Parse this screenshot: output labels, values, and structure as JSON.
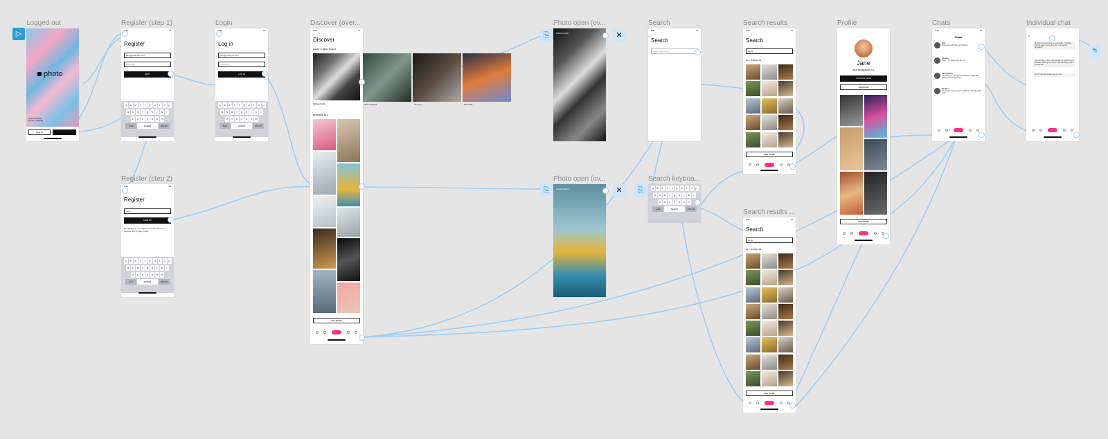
{
  "frames": {
    "logged_out": {
      "label": "Logged out",
      "brand": "photo",
      "login_btn": "LOG IN",
      "footer_name": "Pawel Czerwinski",
      "footer_sub": "@pawel_czerwinski"
    },
    "register1": {
      "label": "Register (step 1)",
      "title": "Register",
      "email_value": "jane@example.com",
      "password_placeholder": "Password",
      "button": "NEXT"
    },
    "login": {
      "label": "Login",
      "title": "Log in",
      "email_value": "jane@example.com",
      "password_placeholder": "Password",
      "button": "LOG IN"
    },
    "register2": {
      "label": "Register (step 2)",
      "title": "Register",
      "name_value": "Jane",
      "button": "SIGN UP",
      "terms": "By signing up, you agree to Photo's Terms of Service and Privacy Policy."
    },
    "discover": {
      "label": "Discover (over...",
      "title": "Discover",
      "section1": "WHAT'S NEW TODAY",
      "section2": "BROWSE ALL",
      "see_more": "SEE MORE",
      "featured": [
        {
          "name": "Ridhwan Nordin",
          "handle": "@ridzjcb"
        },
        {
          "name": "Clem Onojeghuo",
          "handle": "@clemono2"
        },
        {
          "name": "Jon Tyson",
          "handle": "@jontyson"
        },
        {
          "name": "Chema Ma",
          "handle": "@chemama"
        }
      ]
    },
    "photo_open1": {
      "label": "Photo open (ov...",
      "user": "Ridhwan Nordin",
      "handle": "@ridzjcb"
    },
    "photo_open2": {
      "label": "Photo open (ov...",
      "user": "Angelo Pantazis",
      "handle": "@angelopantazis"
    },
    "search": {
      "label": "Search",
      "title": "Search",
      "placeholder": "Search all photos"
    },
    "search_keyboard": {
      "label": "Search keyboa..."
    },
    "search_results1": {
      "label": "Search results",
      "title": "Search",
      "query": "Dogs",
      "section": "ALL RESULTS",
      "see_more": "SEE MORE"
    },
    "search_results2": {
      "label": "Search results ...",
      "title": "Search",
      "query": "Dogs",
      "section": "ALL RESULTS",
      "see_more": "SEE MORE"
    },
    "profile": {
      "label": "Profile",
      "name": "Jane",
      "location": "SAN FRANCISCO, CA",
      "follow": "FOLLOW JANE",
      "message": "MESSAGE",
      "see_more": "SEE MORE"
    },
    "chats": {
      "label": "Chats",
      "title": "Chats",
      "items": [
        {
          "name": "Jane",
          "msg": "Thank you! Will visit you! Hahaha"
        },
        {
          "name": "Whitney",
          "msg": "Hmm... I'm doing it just for me..."
        },
        {
          "name": "Kent Williams",
          "msg": "I'm looking for the artwork behind the rolling hills today and look amazing!"
        },
        {
          "name": "Kai Moss",
          "msg": "Wonderful! You'd you're beautiful the lookings at the look!"
        }
      ]
    },
    "individual_chat": {
      "label": "Individual chat",
      "messages": [
        "Hi there! I'd love to check out your photo. I'm always trying to learn how the pros work. Is it open for discussion?",
        "Ha! That's fine! I can't really help with my tripod but your works are amazing. Not sure if it was something I was going to sell.",
        "I'll hold your idea it was I say, so I can't..."
      ]
    }
  },
  "keyboard": {
    "row1": [
      "q",
      "w",
      "e",
      "r",
      "t",
      "y",
      "u",
      "i",
      "o",
      "p"
    ],
    "row2": [
      "a",
      "s",
      "d",
      "f",
      "g",
      "h",
      "j",
      "k",
      "l"
    ],
    "row3": [
      "z",
      "x",
      "c",
      "v",
      "b",
      "n",
      "m"
    ],
    "space": "space",
    "return": "return",
    "num": "123"
  },
  "colors": {
    "canvas": "#e5e5e5",
    "link": "#9ccdf3",
    "accent_pink": "#ff2d8a",
    "proto_blue": "#2d9cdb"
  },
  "icons": {
    "play": "play-icon",
    "close": "close-icon",
    "device": "device-icon",
    "back": "back-arrow-icon"
  }
}
